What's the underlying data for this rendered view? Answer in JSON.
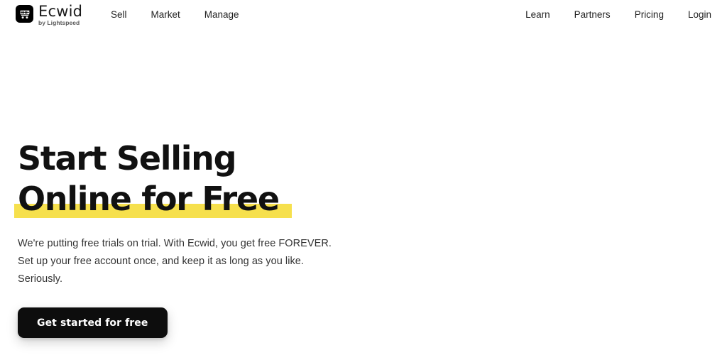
{
  "header": {
    "brand": {
      "icon": "shopping-cart-icon",
      "name": "Ecwid",
      "tagline": "by Lightspeed"
    },
    "nav_left": [
      {
        "label": "Sell"
      },
      {
        "label": "Market"
      },
      {
        "label": "Manage"
      }
    ],
    "nav_right": [
      {
        "label": "Learn"
      },
      {
        "label": "Partners"
      },
      {
        "label": "Pricing"
      },
      {
        "label": "Login"
      }
    ]
  },
  "hero": {
    "title_line_1": "Start Selling",
    "title_line_2": "Online for Free",
    "paragraph": "We're putting free trials on trial. With Ecwid, you get free FOREVER. Set up your free account once, and keep it as long as you like. Seriously.",
    "cta_label": "Get started for free"
  },
  "colors": {
    "highlight_yellow": "#f6e04d",
    "button_background": "#0d0d0d",
    "button_text": "#ffffff",
    "heading_text": "#111111",
    "body_text": "#333333",
    "page_background": "#ffffff"
  }
}
